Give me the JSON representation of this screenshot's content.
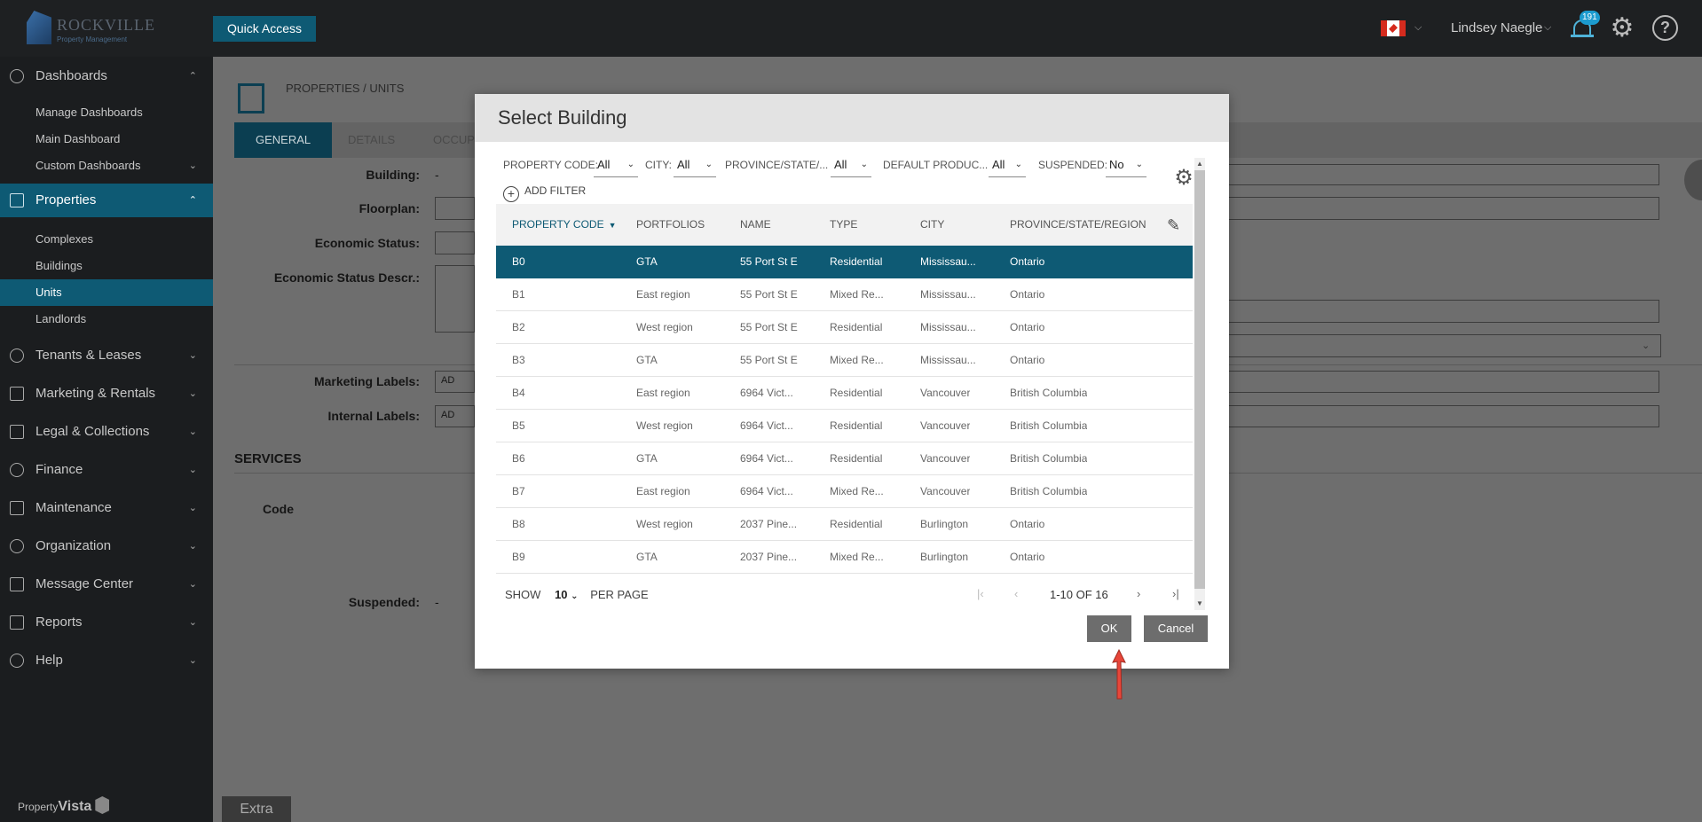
{
  "topbar": {
    "logo_text": "ROCKVILLE",
    "logo_sub": "Property Management",
    "quick_access": "Quick Access",
    "user_name": "Lindsey Naegle",
    "notification_count": "191"
  },
  "sidebar": {
    "items": [
      {
        "label": "Dashboards",
        "expanded": true
      },
      {
        "label": "Properties",
        "expanded": true
      },
      {
        "label": "Tenants & Leases"
      },
      {
        "label": "Marketing & Rentals"
      },
      {
        "label": "Legal & Collections"
      },
      {
        "label": "Finance"
      },
      {
        "label": "Maintenance"
      },
      {
        "label": "Organization"
      },
      {
        "label": "Message Center"
      },
      {
        "label": "Reports"
      },
      {
        "label": "Help"
      }
    ],
    "dashboard_sub": [
      "Manage Dashboards",
      "Main Dashboard",
      "Custom Dashboards"
    ],
    "properties_sub": [
      "Complexes",
      "Buildings",
      "Units",
      "Landlords"
    ],
    "footer_brand_a": "Property",
    "footer_brand_b": "Vista"
  },
  "page": {
    "breadcrumb": "PROPERTIES / UNITS",
    "tabs": [
      "GENERAL",
      "DETAILS",
      "OCCUP"
    ],
    "fields": {
      "building_label": "Building:",
      "building_value": "-",
      "floorplan_label": "Floorplan:",
      "economic_status_label": "Economic Status:",
      "economic_status_descr_label": "Economic Status Descr.:",
      "marketing_labels_label": "Marketing Labels:",
      "internal_labels_label": "Internal Labels:",
      "add_partial": "AD",
      "services_heading": "SERVICES",
      "code_label": "Code",
      "suspended_label": "Suspended:",
      "suspended_value": "-"
    },
    "extra_button": "Extra"
  },
  "dialog": {
    "title": "Select Building",
    "filters": [
      {
        "label": "PROPERTY CODE:",
        "value": "All"
      },
      {
        "label": "CITY:",
        "value": "All"
      },
      {
        "label": "PROVINCE/STATE/...",
        "value": "All"
      },
      {
        "label": "DEFAULT PRODUC...",
        "value": "All"
      },
      {
        "label": "SUSPENDED:",
        "value": "No"
      }
    ],
    "add_filter": "ADD FILTER",
    "columns": [
      "PROPERTY CODE",
      "PORTFOLIOS",
      "NAME",
      "TYPE",
      "CITY",
      "PROVINCE/STATE/REGION"
    ],
    "rows": [
      [
        "B0",
        "GTA",
        "55 Port St E",
        "Residential",
        "Mississau...",
        "Ontario"
      ],
      [
        "B1",
        "East region",
        "55 Port St E",
        "Mixed Re...",
        "Mississau...",
        "Ontario"
      ],
      [
        "B2",
        "West region",
        "55 Port St E",
        "Residential",
        "Mississau...",
        "Ontario"
      ],
      [
        "B3",
        "GTA",
        "55 Port St E",
        "Mixed Re...",
        "Mississau...",
        "Ontario"
      ],
      [
        "B4",
        "East region",
        "6964 Vict...",
        "Residential",
        "Vancouver",
        "British Columbia"
      ],
      [
        "B5",
        "West region",
        "6964 Vict...",
        "Residential",
        "Vancouver",
        "British Columbia"
      ],
      [
        "B6",
        "GTA",
        "6964 Vict...",
        "Residential",
        "Vancouver",
        "British Columbia"
      ],
      [
        "B7",
        "East region",
        "6964 Vict...",
        "Mixed Re...",
        "Vancouver",
        "British Columbia"
      ],
      [
        "B8",
        "West region",
        "2037 Pine...",
        "Residential",
        "Burlington",
        "Ontario"
      ],
      [
        "B9",
        "GTA",
        "2037 Pine...",
        "Mixed Re...",
        "Burlington",
        "Ontario"
      ]
    ],
    "selected_row": 0,
    "pager": {
      "show_label": "SHOW",
      "per_page_value": "10",
      "per_page_label": "PER PAGE",
      "range": "1-10 OF 16"
    },
    "ok_label": "OK",
    "cancel_label": "Cancel"
  },
  "colors": {
    "accent": "#0e5a74",
    "topbar": "#1e2022",
    "sidebar": "#1b1d1f",
    "annotation_arrow": "#e8463a"
  }
}
